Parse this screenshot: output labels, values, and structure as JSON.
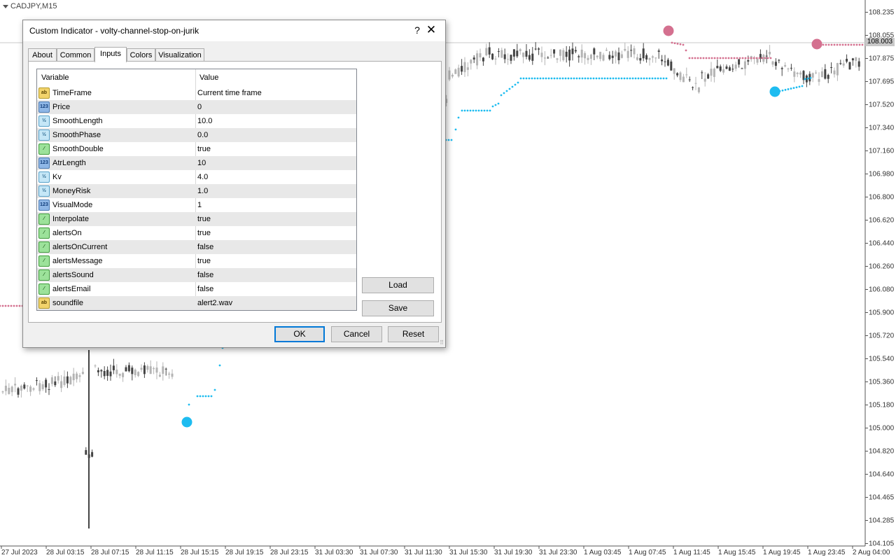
{
  "chart": {
    "symbol": "CADJPY,M15",
    "current_price": "108.003",
    "y_ticks": [
      "108.235",
      "108.055",
      "107.875",
      "107.695",
      "107.520",
      "107.340",
      "107.160",
      "106.980",
      "106.800",
      "106.620",
      "106.440",
      "106.260",
      "106.080",
      "105.900",
      "105.720",
      "105.540",
      "105.360",
      "105.180",
      "105.000",
      "104.820",
      "104.640",
      "104.465",
      "104.285",
      "104.105"
    ],
    "x_ticks": [
      "27 Jul 2023",
      "28 Jul 03:15",
      "28 Jul 07:15",
      "28 Jul 11:15",
      "28 Jul 15:15",
      "28 Jul 19:15",
      "28 Jul 23:15",
      "31 Jul 03:30",
      "31 Jul 07:30",
      "31 Jul 11:30",
      "31 Jul 15:30",
      "31 Jul 19:30",
      "31 Jul 23:30",
      "1 Aug 03:45",
      "1 Aug 07:45",
      "1 Aug 11:45",
      "1 Aug 15:45",
      "1 Aug 19:45",
      "1 Aug 23:45",
      "2 Aug 04:00"
    ],
    "colors": {
      "up_stop": "#1ebcf0",
      "down_stop": "#d4708f",
      "candle": "#b4b4b4",
      "candle_dark": "#444444"
    }
  },
  "dialog": {
    "title": "Custom Indicator - volty-channel-stop-on-jurik",
    "help_glyph": "?",
    "close_glyph": "✕",
    "tabs": [
      {
        "label": "About",
        "active": false
      },
      {
        "label": "Common",
        "active": false
      },
      {
        "label": "Inputs",
        "active": true
      },
      {
        "label": "Colors",
        "active": false
      },
      {
        "label": "Visualization",
        "active": false
      }
    ],
    "grid": {
      "col_variable": "Variable",
      "col_value": "Value",
      "rows": [
        {
          "icon": "ab",
          "icon_text": "ab",
          "name": "TimeFrame",
          "value": "Current time frame"
        },
        {
          "icon": "n123",
          "icon_text": "123",
          "name": "Price",
          "value": "0"
        },
        {
          "icon": "frac",
          "icon_text": "½",
          "name": "SmoothLength",
          "value": "10.0"
        },
        {
          "icon": "frac",
          "icon_text": "½",
          "name": "SmoothPhase",
          "value": "0.0"
        },
        {
          "icon": "bool",
          "icon_text": "⁄",
          "name": "SmoothDouble",
          "value": "true"
        },
        {
          "icon": "n123",
          "icon_text": "123",
          "name": "AtrLength",
          "value": "10"
        },
        {
          "icon": "frac",
          "icon_text": "½",
          "name": "Kv",
          "value": "4.0"
        },
        {
          "icon": "frac",
          "icon_text": "½",
          "name": "MoneyRisk",
          "value": "1.0"
        },
        {
          "icon": "n123",
          "icon_text": "123",
          "name": "VisualMode",
          "value": "1"
        },
        {
          "icon": "bool",
          "icon_text": "⁄",
          "name": "Interpolate",
          "value": "true"
        },
        {
          "icon": "bool",
          "icon_text": "⁄",
          "name": "alertsOn",
          "value": "true"
        },
        {
          "icon": "bool",
          "icon_text": "⁄",
          "name": "alertsOnCurrent",
          "value": "false"
        },
        {
          "icon": "bool",
          "icon_text": "⁄",
          "name": "alertsMessage",
          "value": "true"
        },
        {
          "icon": "bool",
          "icon_text": "⁄",
          "name": "alertsSound",
          "value": "false"
        },
        {
          "icon": "bool",
          "icon_text": "⁄",
          "name": "alertsEmail",
          "value": "false"
        },
        {
          "icon": "ab",
          "icon_text": "ab",
          "name": "soundfile",
          "value": "alert2.wav"
        }
      ]
    },
    "buttons": {
      "load": "Load",
      "save": "Save",
      "ok": "OK",
      "cancel": "Cancel",
      "reset": "Reset"
    }
  }
}
